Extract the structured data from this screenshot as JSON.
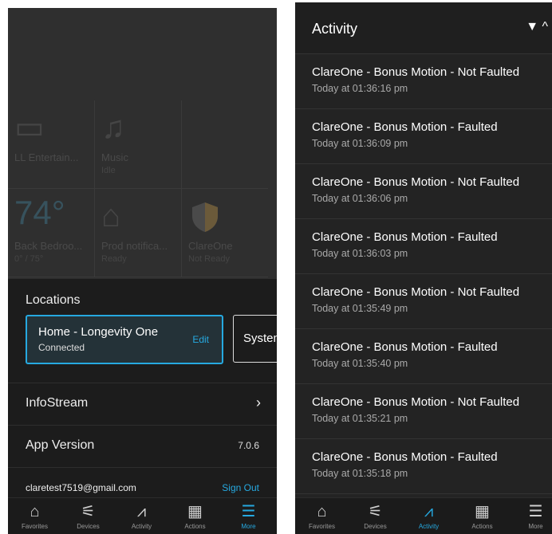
{
  "left": {
    "tiles": [
      {
        "label": "LL Entertain...",
        "sub": "",
        "icon": "tv-icon"
      },
      {
        "label": "Music",
        "sub": "Idle",
        "icon": "music-icon"
      },
      {
        "label": "",
        "sub": "",
        "icon": ""
      },
      {
        "label": "Back Bedroo...",
        "sub": "0° / 75°",
        "temp": "74°",
        "icon": ""
      },
      {
        "label": "Prod notifica...",
        "sub": "Ready",
        "icon": "garage-icon"
      },
      {
        "label": "ClareOne",
        "sub": "Not Ready",
        "icon": "shield-icon"
      }
    ],
    "locations_title": "Locations",
    "location_active": {
      "name": "Home - Longevity One",
      "status": "Connected",
      "edit": "Edit"
    },
    "location_other": {
      "name": "System"
    },
    "infostream": "InfoStream",
    "app_version_label": "App Version",
    "app_version": "7.0.6",
    "email": "claretest7519@gmail.com",
    "sign_out": "Sign Out"
  },
  "nav": [
    {
      "label": "Favorites",
      "icon": "home-icon"
    },
    {
      "label": "Devices",
      "icon": "devices-icon"
    },
    {
      "label": "Activity",
      "icon": "activity-icon"
    },
    {
      "label": "Actions",
      "icon": "calendar-icon"
    },
    {
      "label": "More",
      "icon": "menu-icon"
    }
  ],
  "right": {
    "title": "Activity",
    "items": [
      {
        "text": "ClareOne - Bonus Motion - Not Faulted",
        "time": "Today at 01:36:16 pm"
      },
      {
        "text": "ClareOne - Bonus Motion - Faulted",
        "time": "Today at 01:36:09 pm"
      },
      {
        "text": "ClareOne - Bonus Motion - Not Faulted",
        "time": "Today at 01:36:06 pm"
      },
      {
        "text": "ClareOne - Bonus Motion - Faulted",
        "time": "Today at 01:36:03 pm"
      },
      {
        "text": "ClareOne - Bonus Motion - Not Faulted",
        "time": "Today at 01:35:49 pm"
      },
      {
        "text": "ClareOne - Bonus Motion - Faulted",
        "time": "Today at 01:35:40 pm"
      },
      {
        "text": "ClareOne - Bonus Motion - Not Faulted",
        "time": "Today at 01:35:21 pm"
      },
      {
        "text": "ClareOne - Bonus Motion - Faulted",
        "time": "Today at 01:35:18 pm"
      }
    ]
  },
  "colors": {
    "accent": "#26a9e0",
    "bg": "#1e1e1e"
  }
}
